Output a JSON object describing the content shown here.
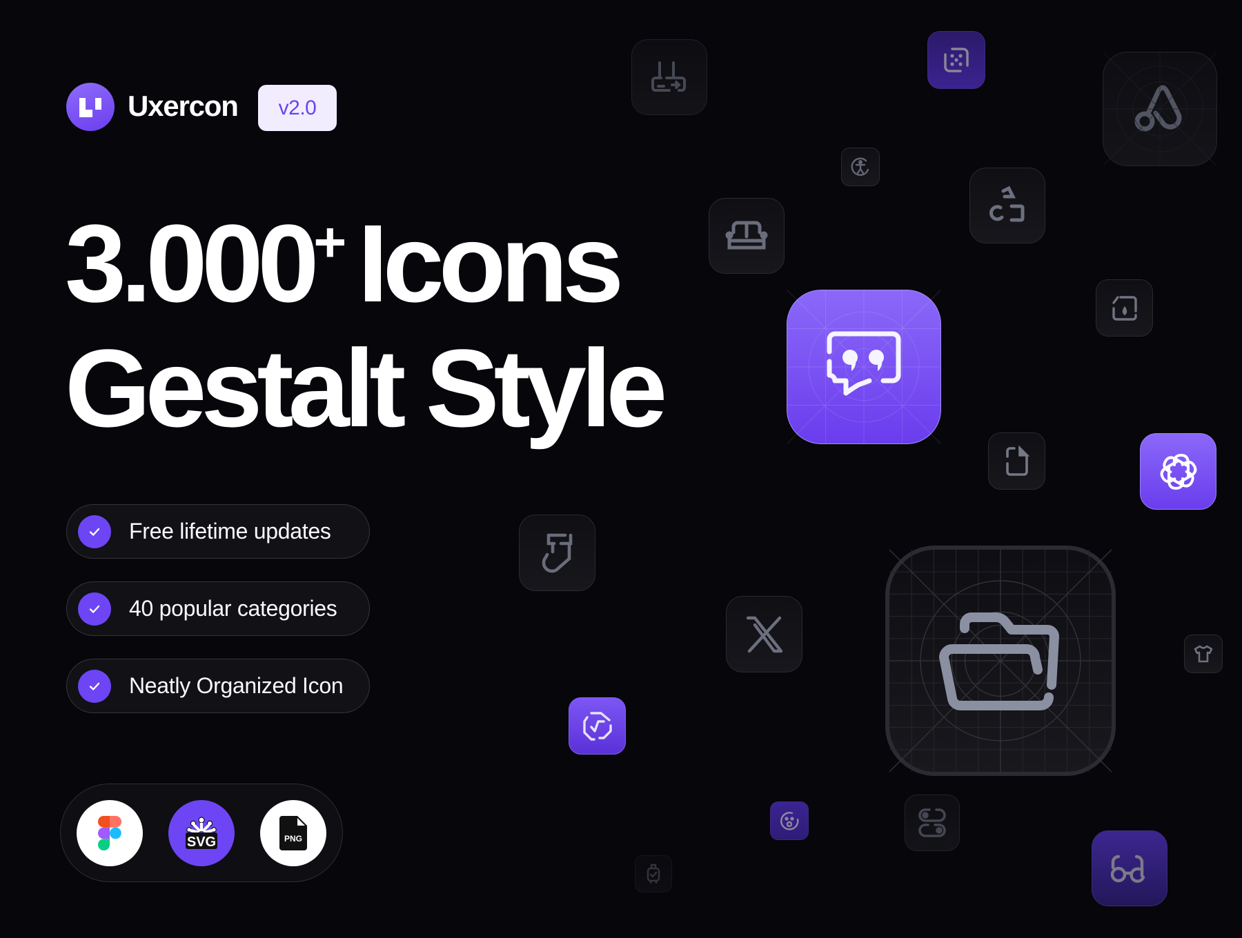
{
  "brand": {
    "name": "Uxercon",
    "version": "v2.0",
    "logo_letter": "u",
    "accent_color": "#6d45f4"
  },
  "headline": {
    "line1_main": "3.000",
    "line1_sup": "+",
    "line1_tail": "Icons",
    "line2": "Gestalt Style"
  },
  "features": [
    {
      "label": "Free lifetime updates",
      "icon": "check-icon"
    },
    {
      "label": "40 popular categories",
      "icon": "check-icon"
    },
    {
      "label": "Neatly Organized Icon",
      "icon": "check-icon"
    }
  ],
  "formats": [
    {
      "name": "Figma",
      "icon": "figma-icon"
    },
    {
      "name": "SVG",
      "icon": "svg-icon",
      "label": "SVG"
    },
    {
      "name": "PNG",
      "icon": "png-file-icon",
      "label": "PNG"
    }
  ],
  "showcase_icons": [
    "router-icon",
    "dice-icon",
    "airbnb-icon",
    "accessibility-icon",
    "shapes-icon",
    "sofa-icon",
    "quote-chat-icon",
    "paint-box-icon",
    "file-icon",
    "openai-icon",
    "sock-icon",
    "x-logo-icon",
    "folder-open-icon",
    "tshirt-icon",
    "sqrt-badge-icon",
    "surprised-face-icon",
    "toggle-icon",
    "luggage-icon",
    "glasses-icon"
  ]
}
